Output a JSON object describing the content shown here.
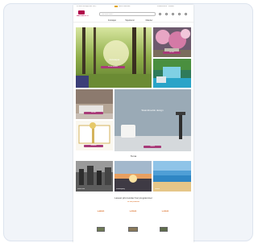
{
  "topbar": {
    "left_text": "Fri frakt ved kjøp over 500,-",
    "middle_text": "Norsk nettbutikk",
    "right_text": "Kundeservice · Kontakt"
  },
  "header": {
    "logo_text": "MARTINE & CO",
    "search_placeholder": "Søk etter motiv...",
    "icons": [
      "user-icon",
      "heart-icon",
      "cart-icon",
      "menu-icon"
    ]
  },
  "nav": {
    "items": [
      "Fototapet",
      "Tapetkunst",
      "Malerier"
    ]
  },
  "hero": {
    "title": "Fototapet",
    "cta_label": "Se alle motiver",
    "side_cta_label": "Se mer",
    "second_title": "Skandinavisk design",
    "second_cta": "Utforsk",
    "gift_label": "Gavekort"
  },
  "section_title": "Tema",
  "theme_labels": [
    "Svart-hvitt",
    "Solnedgang",
    "Strand"
  ],
  "favorites": {
    "title": "Lavest pris kunder har programmer",
    "subtitle": "Se alle produkter",
    "prices": [
      "kr 449,00",
      "kr 599,00",
      "kr 349,00"
    ]
  },
  "colors": {
    "accent": "#a83a78",
    "brand": "#b0004a",
    "price": "#d35400",
    "card_bg": "#f1f4f9"
  }
}
